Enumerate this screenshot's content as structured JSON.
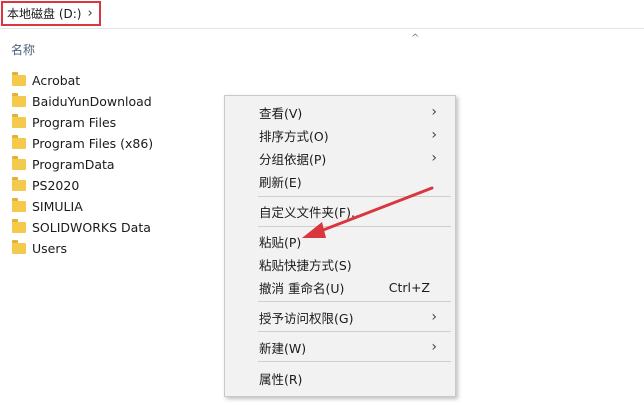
{
  "address_bar": {
    "path_label": "本地磁盘 (D:)",
    "chevron": "›"
  },
  "columns": {
    "name_header": "名称",
    "sort_indicator": "^"
  },
  "folders": [
    "Acrobat",
    "BaiduYunDownload",
    "Program Files",
    "Program Files (x86)",
    "ProgramData",
    "PS2020",
    "SIMULIA",
    "SOLIDWORKS Data",
    "Users"
  ],
  "context_menu": {
    "view": "查看(V)",
    "sort": "排序方式(O)",
    "group": "分组依据(P)",
    "refresh": "刷新(E)",
    "customize": "自定义文件夹(F)...",
    "paste": "粘贴(P)",
    "paste_shortcut": "粘贴快捷方式(S)",
    "undo_rename": "撤消 重命名(U)",
    "undo_shortcut": "Ctrl+Z",
    "grant_access": "授予访问权限(G)",
    "new": "新建(W)",
    "properties": "属性(R)",
    "submenu_arrow": "›"
  },
  "colors": {
    "highlight_red": "#d9363e",
    "folder_yellow": "#f5c94b"
  },
  "icons": [
    "folder-icon",
    "chevron-right-icon",
    "sort-up-icon",
    "red-arrow-annotation"
  ]
}
